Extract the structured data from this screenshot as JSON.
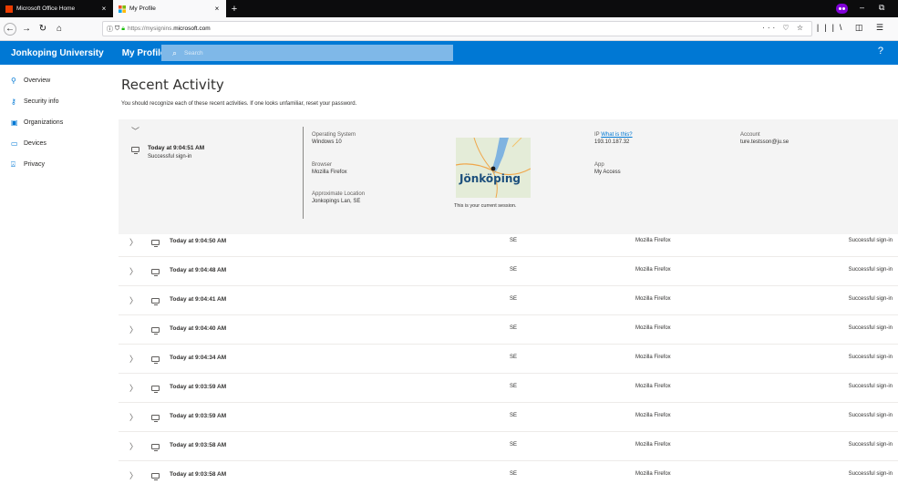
{
  "browser": {
    "tabs": [
      {
        "title": "Microsoft Office Home",
        "active": false,
        "favicon": "office-icon",
        "favicon_color": "#eb3c00"
      },
      {
        "title": "My Profile",
        "active": true,
        "favicon": "microsoft-icon",
        "favicon_color": "#0078d4"
      }
    ],
    "new_tab_label": "+",
    "url_prefix": "https://mysignins.",
    "url_domain": "microsoft.com",
    "page_actions": "··· ♡ ☆",
    "toolbar_icons": "|||\\ ◫ ☰",
    "window_controls": {
      "minimize": "–",
      "restore": "⧉"
    }
  },
  "app": {
    "org_name": "Jonkoping University",
    "title": "My Profile",
    "search_placeholder": "Search",
    "help": "?",
    "accent_color": "#0078d4"
  },
  "sidebar": {
    "items": [
      {
        "label": "Overview",
        "icon": "person-icon"
      },
      {
        "label": "Security info",
        "icon": "key-person-icon"
      },
      {
        "label": "Organizations",
        "icon": "briefcase-icon"
      },
      {
        "label": "Devices",
        "icon": "laptop-icon"
      },
      {
        "label": "Privacy",
        "icon": "lock-icon"
      }
    ]
  },
  "main": {
    "title": "Recent Activity",
    "subtitle": "You should recognize each of these recent activities. If one looks unfamiliar, reset your password.",
    "expanded": {
      "time": "Today at 9:04:51 AM",
      "status": "Successful sign-in",
      "os_label": "Operating System",
      "os_value": "Windows 10",
      "browser_label": "Browser",
      "browser_value": "Mozilla Firefox",
      "location_label": "Approximate Location",
      "location_value": "Jonkopings Lan, SE",
      "map_city": "Jönköping",
      "map_caption": "This is your current session.",
      "ip_label": "IP",
      "ip_link": "What is this?",
      "ip_value": "193.10.187.32",
      "app_label": "App",
      "app_value": "My Access",
      "account_label": "Account",
      "account_value": "ture.testsson@ju.se"
    },
    "rows": [
      {
        "time": "Today at 9:04:50 AM",
        "location": "SE",
        "browser": "Mozilla Firefox",
        "status": "Successful sign-in"
      },
      {
        "time": "Today at 9:04:48 AM",
        "location": "SE",
        "browser": "Mozilla Firefox",
        "status": "Successful sign-in"
      },
      {
        "time": "Today at 9:04:41 AM",
        "location": "SE",
        "browser": "Mozilla Firefox",
        "status": "Successful sign-in"
      },
      {
        "time": "Today at 9:04:40 AM",
        "location": "SE",
        "browser": "Mozilla Firefox",
        "status": "Successful sign-in"
      },
      {
        "time": "Today at 9:04:34 AM",
        "location": "SE",
        "browser": "Mozilla Firefox",
        "status": "Successful sign-in"
      },
      {
        "time": "Today at 9:03:59 AM",
        "location": "SE",
        "browser": "Mozilla Firefox",
        "status": "Successful sign-in"
      },
      {
        "time": "Today at 9:03:59 AM",
        "location": "SE",
        "browser": "Mozilla Firefox",
        "status": "Successful sign-in"
      },
      {
        "time": "Today at 9:03:58 AM",
        "location": "SE",
        "browser": "Mozilla Firefox",
        "status": "Successful sign-in"
      },
      {
        "time": "Today at 9:03:58 AM",
        "location": "SE",
        "browser": "Mozilla Firefox",
        "status": "Successful sign-in"
      }
    ]
  }
}
